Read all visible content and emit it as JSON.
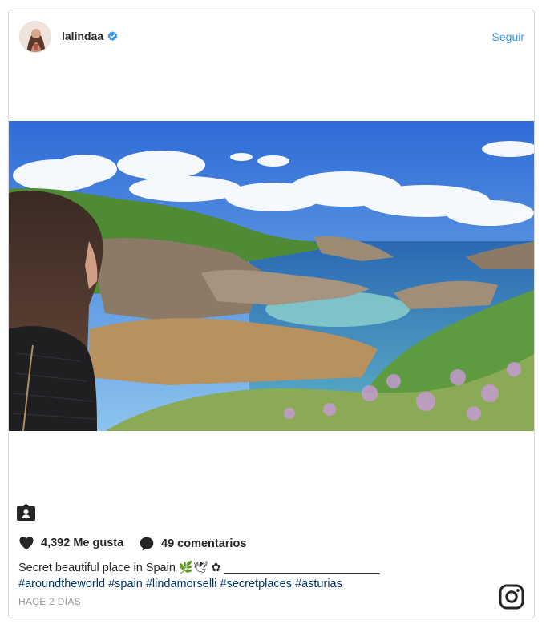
{
  "post": {
    "username": "lalindaa",
    "follow_label": "Seguir",
    "likes_text": "4,392 Me gusta",
    "comments_text": "49 comentarios",
    "caption_text": "Secret beautiful place in Spain 🌿🕊 ✿ ________________________",
    "hashtags": [
      "#aroundtheworld",
      "#spain",
      "#lindamorselli",
      "#secretplaces",
      "#asturias"
    ],
    "time": "HACE 2 DÍAS"
  },
  "icons": {
    "verified": "verified-badge-icon",
    "like": "heart-icon",
    "comment": "comment-bubble-icon",
    "user_tag": "user-tag-icon",
    "brand": "instagram-logo-icon"
  },
  "colors": {
    "link_blue": "#3897f0",
    "hashtag_blue": "#003569",
    "muted": "#999999"
  }
}
